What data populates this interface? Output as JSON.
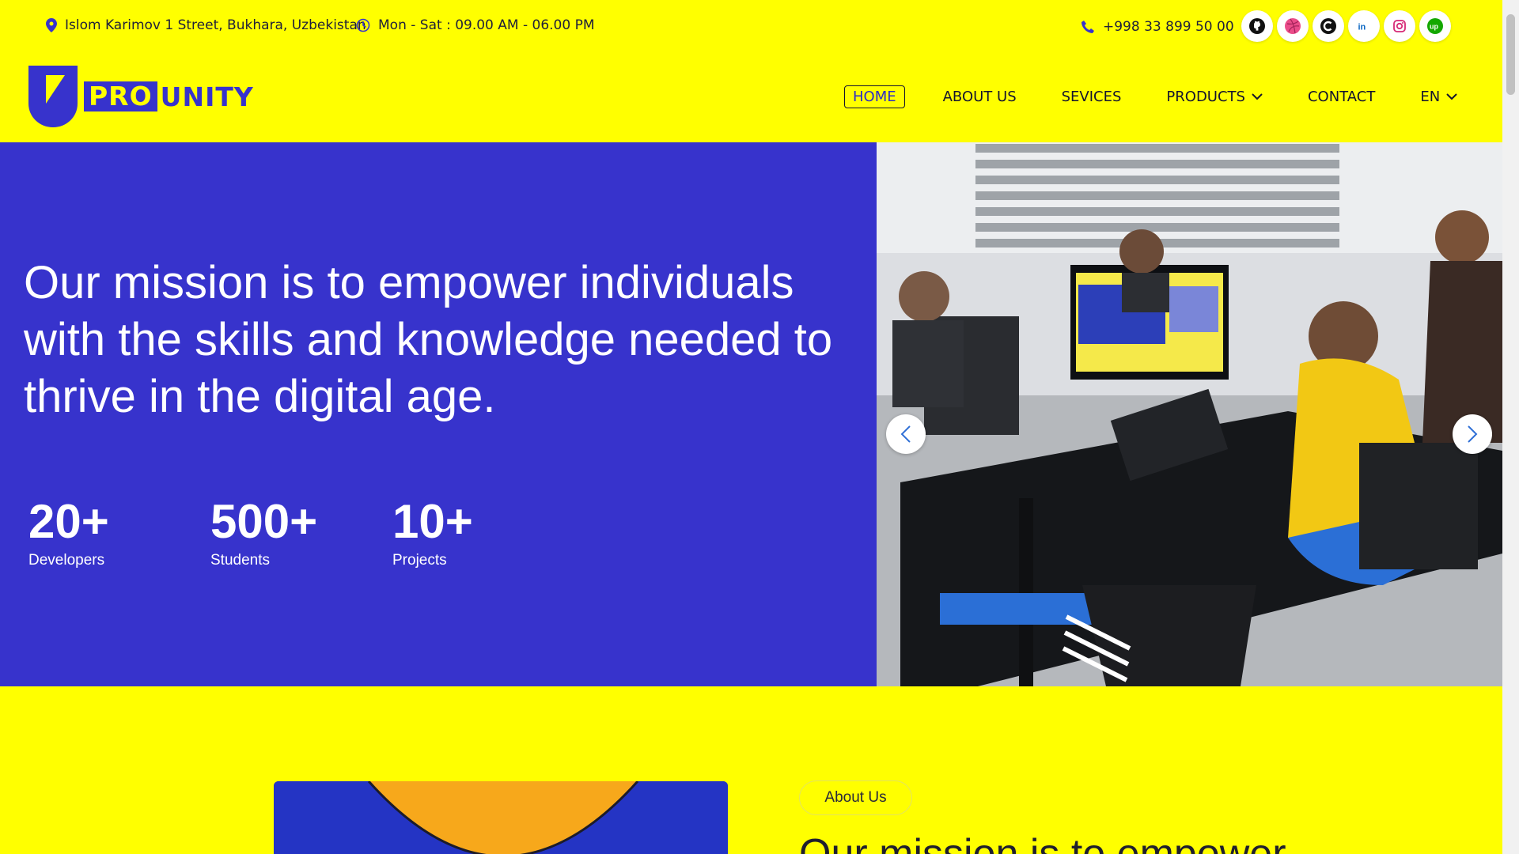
{
  "topbar": {
    "address": "Islom Karimov 1 Street, Bukhara, Uzbekistan",
    "hours": "Mon - Sat : 09.00 AM - 06.00 PM",
    "phone": "+998 33 899 50 00",
    "socials": [
      "github-icon",
      "dribbble-icon",
      "codepen-icon",
      "linkedin-icon",
      "instagram-icon",
      "upwork-icon"
    ]
  },
  "logo": {
    "pro": "PRO",
    "unity": "UNITY"
  },
  "nav": {
    "home": "HOME",
    "about": "ABOUT US",
    "services": "SEVICES",
    "products": "PRODUCTS",
    "contact": "CONTACT",
    "language": "EN"
  },
  "hero": {
    "title": "Our mission is to empower individuals with the skills and knowledge needed to thrive in the digital age.",
    "stats": [
      {
        "value": "20+",
        "label": "Developers"
      },
      {
        "value": "500+",
        "label": "Students"
      },
      {
        "value": "10+",
        "label": "Projects"
      }
    ]
  },
  "about": {
    "badge": "About Us",
    "heading": "Our mission is to empower"
  },
  "colors": {
    "brand_yellow": "#ffff00",
    "brand_blue": "#3733cc"
  }
}
